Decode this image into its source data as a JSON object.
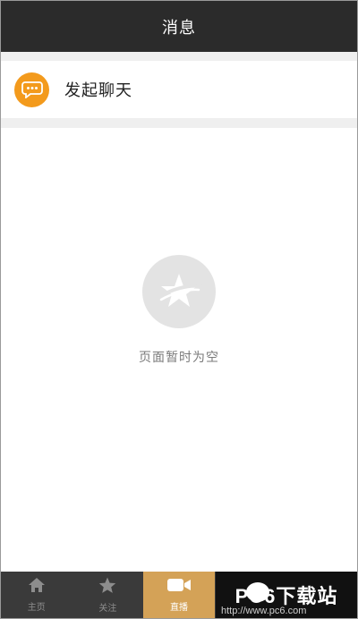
{
  "header": {
    "title": "消息"
  },
  "chat_entry": {
    "label": "发起聊天",
    "icon": "chat-bubble-icon",
    "icon_color": "#f39a1c"
  },
  "empty_state": {
    "icon": "star-logo-icon",
    "text": "页面暂时为空"
  },
  "tabbar": {
    "active_color": "#d4a257",
    "items": [
      {
        "label": "主页",
        "icon": "home-icon"
      },
      {
        "label": "关注",
        "icon": "star-icon"
      },
      {
        "label": "直播",
        "icon": "video-camera-icon"
      },
      {
        "label": "",
        "icon": "chat-icon"
      },
      {
        "label": "",
        "icon": "profile-icon"
      }
    ]
  },
  "watermark": {
    "text": "PC6下载站",
    "url": "http://www.pc6.com"
  }
}
